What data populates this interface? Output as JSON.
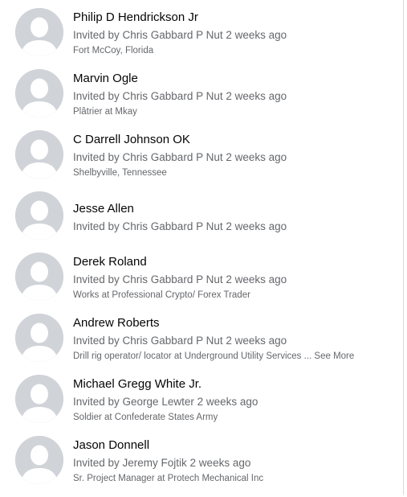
{
  "members": [
    {
      "name": "Philip D Hendrickson Jr",
      "invited": "Invited by Chris Gabbard P Nut 2 weeks ago",
      "detail": "Fort McCoy, Florida"
    },
    {
      "name": "Marvin Ogle",
      "invited": "Invited by Chris Gabbard P Nut 2 weeks ago",
      "detail": "Plâtrier at Mkay"
    },
    {
      "name": "C Darrell Johnson OK",
      "invited": "Invited by Chris Gabbard P Nut 2 weeks ago",
      "detail": "Shelbyville, Tennessee"
    },
    {
      "name": "Jesse Allen",
      "invited": "Invited by Chris Gabbard P Nut 2 weeks ago",
      "detail": ""
    },
    {
      "name": "Derek Roland",
      "invited": "Invited by Chris Gabbard P Nut 2 weeks ago",
      "detail": "Works at Professional Crypto/ Forex Trader"
    },
    {
      "name": "Andrew Roberts",
      "invited": "Invited by Chris Gabbard P Nut 2 weeks ago",
      "detail": "Drill rig operator/ locator at Underground Utility Services ...",
      "see_more": "See More"
    },
    {
      "name": "Michael Gregg White Jr.",
      "invited": "Invited by George Lewter 2 weeks ago",
      "detail": "Soldier at Confederate States Army"
    },
    {
      "name": "Jason Donnell",
      "invited": "Invited by Jeremy Fojtik 2 weeks ago",
      "detail": "Sr. Project Manager at Protech Mechanical Inc"
    }
  ]
}
